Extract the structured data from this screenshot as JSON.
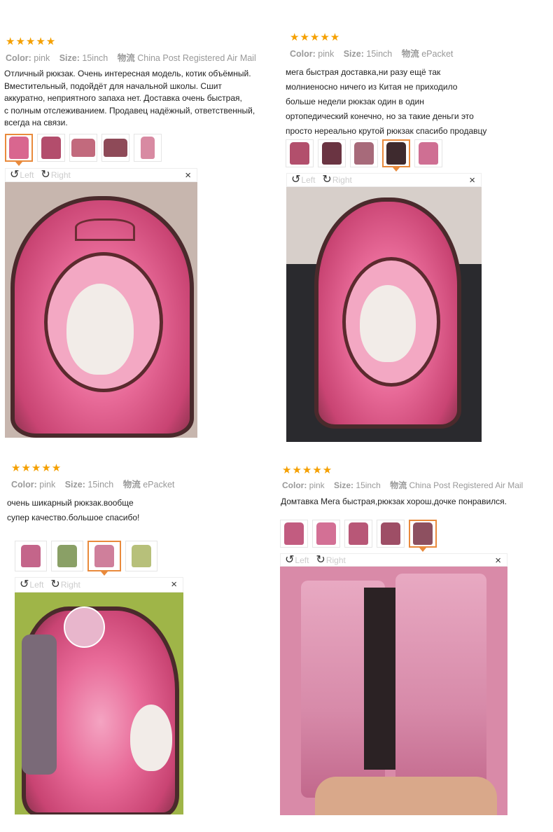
{
  "reviews": [
    {
      "stars": "★★★★★",
      "color_label": "Color:",
      "color_value": "pink",
      "size_label": "Size:",
      "size_value": "15inch",
      "shipping_label": "物流",
      "shipping_value": "China Post Registered Air Mail",
      "text": "Отличный рюкзак. Очень интересная модель, котик объёмный.\nВместительный, подойдёт для начальной школы. Сшит\nаккуратно, неприятного запаха нет. Доставка очень быстрая,\nс полным отслеживанием. Продавец надёжный, ответственный,\nвсегда на связи.",
      "viewer": {
        "left": "Left",
        "right": "Right",
        "close": "×"
      }
    },
    {
      "stars": "★★★★★",
      "color_label": "Color:",
      "color_value": "pink",
      "size_label": "Size:",
      "size_value": "15inch",
      "shipping_label": "物流",
      "shipping_value": "ePacket",
      "text": " мега быстрая доставка,ни разу ещё так\nмолниеносно ничего из Китая не приходило\n больше недели рюкзак один в один\nортопедический конечно, но за такие деньги это\n просто нереально крутой рюкзак  спасибо продавцу",
      "viewer": {
        "left": "Left",
        "right": "Right",
        "close": "×"
      }
    },
    {
      "stars": "★★★★★",
      "color_label": "Color:",
      "color_value": "pink",
      "size_label": "Size:",
      "size_value": "15inch",
      "shipping_label": "物流",
      "shipping_value": "ePacket",
      "text": " очень шикарный рюкзак.вообще\nсупер качество.большое спасибо!",
      "viewer": {
        "left": "Left",
        "right": "Right",
        "close": "×"
      }
    },
    {
      "stars": "★★★★★",
      "color_label": "Color:",
      "color_value": "pink",
      "size_label": "Size:",
      "size_value": "15inch",
      "shipping_label": "物流",
      "shipping_value": "China Post Registered Air Mail",
      "text": "Домтавка Мега быстрая,рюкзак хорош,дочке понравился.",
      "viewer": {
        "left": "Left",
        "right": "Right",
        "close": "×"
      }
    }
  ],
  "colors": {
    "star": "#f5a000",
    "active_thumb": "#e98a3c",
    "meta": "#999999"
  },
  "icons": {
    "rotate_left": "rotate-left-icon",
    "rotate_right": "rotate-right-icon",
    "close": "close-icon"
  }
}
